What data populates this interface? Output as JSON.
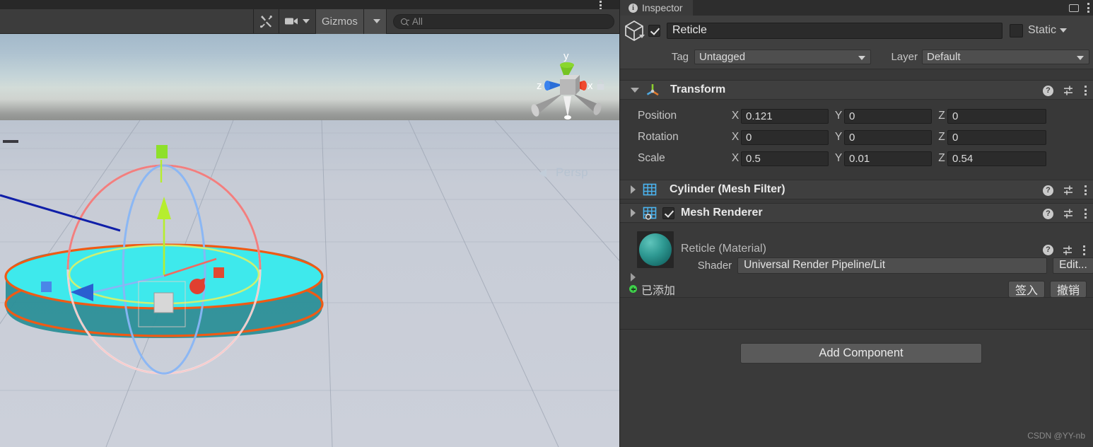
{
  "scene": {
    "toolbar": {
      "tools_icon": "tools-wrench-icon",
      "camera_icon": "camera-icon",
      "gizmos_label": "Gizmos",
      "search_placeholder": "All",
      "search_value": "",
      "search_icon": "search-icon"
    },
    "menu_icon": "vertical-dots-icon",
    "gizmo": {
      "axis_x": "x",
      "axis_y": "y",
      "axis_z": "z",
      "projection_label": "Persp",
      "lock_icon": "lock-icon"
    },
    "colors": {
      "sky_top": "#a3b9ca",
      "sky_mid": "#c4d4d8",
      "horizon": "#8d8f8d",
      "ground": "#c7ccd6",
      "object_fill": "#3ee9ec",
      "selection_outline": "#f05a14",
      "gizmo_x": "#e03020",
      "gizmo_y": "#9ee62a",
      "gizmo_z": "#1f4ed8",
      "rotate_sphere": "#e6e6e6"
    }
  },
  "inspector": {
    "tab_label": "Inspector",
    "tab_icon": "info-icon",
    "window_icon": "window-icon",
    "menu_icon": "vertical-dots-icon",
    "object": {
      "icon": "cube-icon",
      "enabled": true,
      "name": "Reticle",
      "static_label": "Static",
      "static_checked": false
    },
    "tag_label": "Tag",
    "tag_value": "Untagged",
    "layer_label": "Layer",
    "layer_value": "Default",
    "components": [
      {
        "name": "Transform",
        "icon": "transform-axis-icon",
        "expanded": true,
        "has_checkbox": false,
        "rows": [
          {
            "label": "Position",
            "x": "0.121",
            "y": "0",
            "z": "0"
          },
          {
            "label": "Rotation",
            "x": "0",
            "y": "0",
            "z": "0"
          },
          {
            "label": "Scale",
            "x": "0.5",
            "y": "0.01",
            "z": "0.54"
          }
        ]
      },
      {
        "name": "Cylinder (Mesh Filter)",
        "icon": "mesh-filter-grid-icon",
        "expanded": false,
        "has_checkbox": false
      },
      {
        "name": "Mesh Renderer",
        "icon": "mesh-renderer-grid-icon",
        "expanded": false,
        "has_checkbox": true,
        "checked": true
      }
    ],
    "axis_labels": {
      "x": "X",
      "y": "Y",
      "z": "Z"
    },
    "component_tools": {
      "help_icon": "help-icon",
      "preset_icon": "preset-settings-icon",
      "menu_icon": "vertical-dots-icon"
    },
    "material": {
      "title": "Reticle (Material)",
      "preview_icon": "material-sphere-preview",
      "shader_label": "Shader",
      "shader_value": "Universal Render Pipeline/Lit",
      "edit_button": "Edit..."
    },
    "version_control": {
      "status_icon": "added-plus-icon",
      "status_text": "已添加",
      "checkin_button": "签入",
      "revert_button": "撤销"
    },
    "add_component_button": "Add Component"
  },
  "watermark": "CSDN @YY-nb"
}
